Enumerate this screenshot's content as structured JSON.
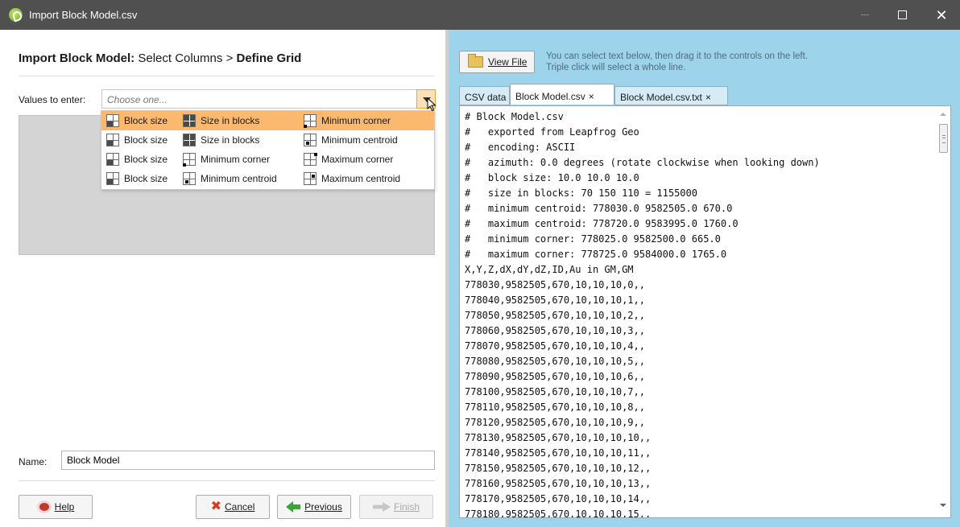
{
  "window": {
    "title": "Import Block Model.csv"
  },
  "wizard": {
    "title_bold": "Import Block Model:",
    "step1": "Select Columns",
    "separator": ">",
    "step2": "Define Grid"
  },
  "values_field": {
    "label": "Values to enter:",
    "placeholder": "Choose one..."
  },
  "dropdown": {
    "rows": [
      {
        "items": [
          {
            "icon": "block-size-icon",
            "label": "Block size"
          },
          {
            "icon": "size-in-blocks-icon",
            "label": "Size in blocks"
          },
          {
            "icon": "minimum-corner-icon",
            "label": "Minimum corner"
          }
        ],
        "selected": true
      },
      {
        "items": [
          {
            "icon": "block-size-icon",
            "label": "Block size"
          },
          {
            "icon": "size-in-blocks-icon",
            "label": "Size in blocks"
          },
          {
            "icon": "minimum-centroid-icon",
            "label": "Minimum centroid"
          }
        ],
        "selected": false
      },
      {
        "items": [
          {
            "icon": "block-size-icon",
            "label": "Block size"
          },
          {
            "icon": "minimum-corner-icon",
            "label": "Minimum corner"
          },
          {
            "icon": "maximum-corner-icon",
            "label": "Maximum corner"
          }
        ],
        "selected": false
      },
      {
        "items": [
          {
            "icon": "block-size-icon",
            "label": "Block size"
          },
          {
            "icon": "minimum-centroid-icon",
            "label": "Minimum centroid"
          },
          {
            "icon": "maximum-centroid-icon",
            "label": "Maximum centroid"
          }
        ],
        "selected": false
      }
    ]
  },
  "name_field": {
    "label": "Name:",
    "value": "Block Model"
  },
  "buttons": {
    "help": "Help",
    "cancel": "Cancel",
    "previous": "Previous",
    "finish": "Finish"
  },
  "right": {
    "view_file": "View File",
    "hint_line1": "You can select text below, then drag it to the controls on the left.",
    "hint_line2": "Triple click will select a whole line.",
    "tabs": [
      {
        "label": "CSV data",
        "active": false,
        "closable": false
      },
      {
        "label": "Block Model.csv",
        "active": true,
        "closable": true
      },
      {
        "label": "Block Model.csv.txt",
        "active": false,
        "closable": true
      }
    ],
    "close_glyph": "×",
    "csv_lines": [
      "# Block Model.csv",
      "#   exported from Leapfrog Geo",
      "#   encoding: ASCII",
      "#   azimuth: 0.0 degrees (rotate clockwise when looking down)",
      "#   block size: 10.0 10.0 10.0",
      "#   size in blocks: 70 150 110 = 1155000",
      "#   minimum centroid: 778030.0 9582505.0 670.0",
      "#   maximum centroid: 778720.0 9583995.0 1760.0",
      "#   minimum corner: 778025.0 9582500.0 665.0",
      "#   maximum corner: 778725.0 9584000.0 1765.0",
      "X,Y,Z,dX,dY,dZ,ID,Au in GM,GM",
      "778030,9582505,670,10,10,10,0,,",
      "778040,9582505,670,10,10,10,1,,",
      "778050,9582505,670,10,10,10,2,,",
      "778060,9582505,670,10,10,10,3,,",
      "778070,9582505,670,10,10,10,4,,",
      "778080,9582505,670,10,10,10,5,,",
      "778090,9582505,670,10,10,10,6,,",
      "778100,9582505,670,10,10,10,7,,",
      "778110,9582505,670,10,10,10,8,,",
      "778120,9582505,670,10,10,10,9,,",
      "778130,9582505,670,10,10,10,10,,",
      "778140,9582505,670,10,10,10,11,,",
      "778150,9582505,670,10,10,10,12,,",
      "778160,9582505,670,10,10,10,13,,",
      "778170,9582505,670,10,10,10,14,,",
      "778180,9582505,670,10,10,10,15,,"
    ]
  },
  "colors": {
    "titlebar": "#505050",
    "right_bg": "#9ed3ec",
    "selection": "#fbb970"
  }
}
